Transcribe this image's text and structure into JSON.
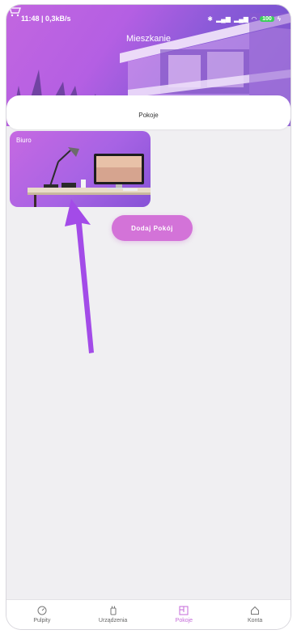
{
  "status_bar": {
    "time_speed": "11:48 | 0,3kB/s",
    "battery": "100"
  },
  "header": {
    "title": "Mieszkanie"
  },
  "tabs": {
    "active_label": "Pokoje"
  },
  "rooms": [
    {
      "name": "Biuro"
    }
  ],
  "actions": {
    "add_room_label": "Dodaj Pokój"
  },
  "bottom_nav": [
    {
      "label": "Pulpity",
      "icon": "gauge-icon",
      "active": false
    },
    {
      "label": "Urządzenia",
      "icon": "plug-icon",
      "active": false
    },
    {
      "label": "Pokoje",
      "icon": "room-icon",
      "active": true
    },
    {
      "label": "Konta",
      "icon": "home-icon",
      "active": false
    }
  ],
  "colors": {
    "accent": "#c46ad8",
    "button": "#d373d8",
    "hero": "#b45fe3",
    "arrow": "#a34be8"
  }
}
